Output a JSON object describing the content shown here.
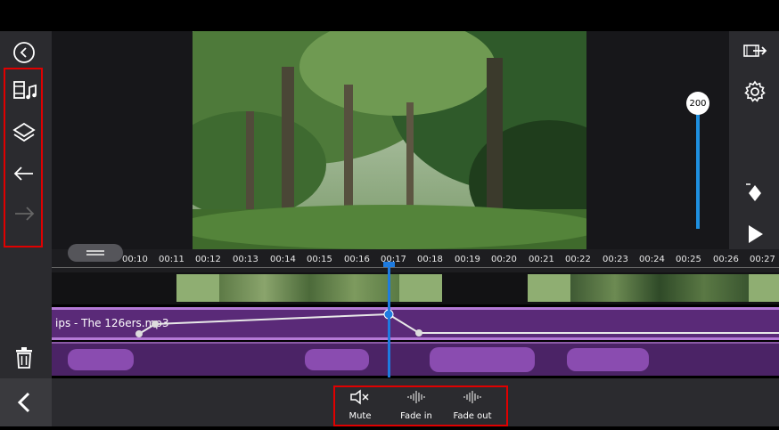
{
  "left_toolbar": {
    "icons": [
      "back-circle-icon",
      "media-music-icon",
      "layers-icon",
      "undo-icon",
      "redo-icon",
      "trash-icon"
    ]
  },
  "right_toolbar": {
    "icons": [
      "export-icon",
      "settings-icon",
      "keyframe-icon",
      "play-icon"
    ],
    "volume_value": "200"
  },
  "timeline": {
    "time_labels": [
      "00:10",
      "00:11",
      "00:12",
      "00:13",
      "00:14",
      "00:15",
      "00:16",
      "00:17",
      "00:18",
      "00:19",
      "00:20",
      "00:21",
      "00:22",
      "00:23",
      "00:24",
      "00:25",
      "00:26",
      "00:27"
    ],
    "playhead_time": "00:17",
    "audio_clip_name": "ips - The 126ers.mp3"
  },
  "bottom_tools": {
    "mute_label": "Mute",
    "fade_in_label": "Fade in",
    "fade_out_label": "Fade out"
  },
  "colors": {
    "highlight": "#e00000",
    "audio_purple": "#5a2a78",
    "playhead": "#1e7be0"
  }
}
